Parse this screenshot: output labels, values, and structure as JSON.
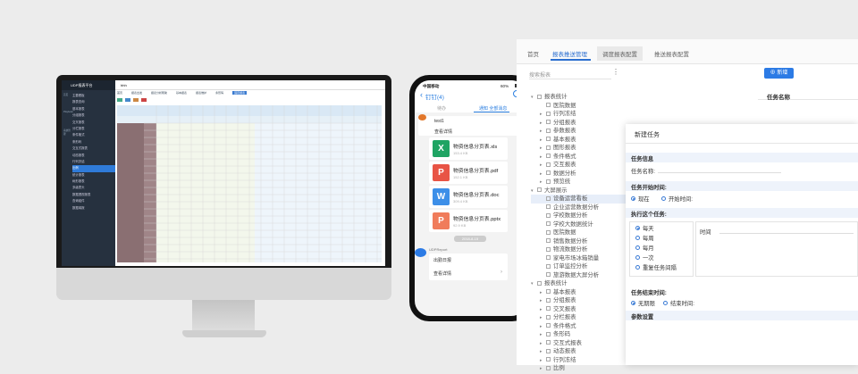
{
  "desktop": {
    "app_title": "UDP报表平台",
    "top_label": "hhh",
    "tabs": [
      "首页",
      "报表出发",
      "报表分析帮助",
      "基本报表",
      "报表维护",
      "条形码",
      "固定报表"
    ],
    "menu": [
      "主要看板",
      "报表查询",
      "基本报表",
      "分组报表",
      "交叉报表",
      "分栏报表",
      "条件格式",
      "条形码",
      "交互式报表",
      "动态报表",
      "行列冻结",
      "比例",
      "统计报表",
      "树形报表",
      "多级表头",
      "数据透视报表",
      "查询组件",
      "数据填报"
    ],
    "left_icons": [
      "首页",
      "Playbook",
      "系统管理"
    ]
  },
  "phone": {
    "carrier": "中国移动",
    "battery": "60%",
    "back_label": "钉钉(4)",
    "tab_left": "待办",
    "tab_right": "通知 全部消息",
    "sender": "test1",
    "view_detail": "查看详情",
    "files": [
      {
        "name": "物资信息分页表.xls",
        "size": "153.4 KB",
        "color": "#1fa463",
        "letter": "X"
      },
      {
        "name": "物资信息分页表.pdf",
        "size": "152.1 KB",
        "color": "#e85445",
        "letter": "P"
      },
      {
        "name": "物资信息分页表.doc",
        "size": "309.4 KB",
        "color": "#3d8fe8",
        "letter": "W"
      },
      {
        "name": "物资信息分页表.pptx",
        "size": "92.9 KB",
        "color": "#f07c5b",
        "letter": "P"
      }
    ],
    "time_badge": "2018-8-15",
    "bot_name": "UDPReport",
    "notice": "出勤日报",
    "view_detail2": "查看详情"
  },
  "manager": {
    "tabs": [
      "首页",
      "报表推送管理",
      "调度报表配置",
      "推送报表配置"
    ],
    "search_placeholder": "搜索报表",
    "new_button": "新增",
    "report_name_header": "任务名称",
    "tree": [
      {
        "label": "报表统计",
        "level": 0,
        "arrow": "▾"
      },
      {
        "label": "医院数据",
        "level": 1,
        "arrow": ""
      },
      {
        "label": "行列冻结",
        "level": 1,
        "arrow": "▸"
      },
      {
        "label": "分组报表",
        "level": 1,
        "arrow": "▸"
      },
      {
        "label": "参数报表",
        "level": 1,
        "arrow": "▸"
      },
      {
        "label": "基本报表",
        "level": 1,
        "arrow": "▸"
      },
      {
        "label": "图形报表",
        "level": 1,
        "arrow": "▸"
      },
      {
        "label": "条件格式",
        "level": 1,
        "arrow": "▸"
      },
      {
        "label": "交互报表",
        "level": 1,
        "arrow": "▸"
      },
      {
        "label": "数据分析",
        "level": 1,
        "arrow": "▸"
      },
      {
        "label": "预览统",
        "level": 1,
        "arrow": "▸"
      },
      {
        "label": "大屏展示",
        "level": 0,
        "arrow": "▾"
      },
      {
        "label": "设备运营看板",
        "level": 1,
        "arrow": ""
      },
      {
        "label": "企业运营数据分析",
        "level": 1,
        "arrow": ""
      },
      {
        "label": "学校数据分析",
        "level": 1,
        "arrow": ""
      },
      {
        "label": "学校大数据统计",
        "level": 1,
        "arrow": ""
      },
      {
        "label": "医院数据",
        "level": 1,
        "arrow": ""
      },
      {
        "label": "销售数据分析",
        "level": 1,
        "arrow": ""
      },
      {
        "label": "物流数据分析",
        "level": 1,
        "arrow": ""
      },
      {
        "label": "家电市场冰箱销量",
        "level": 1,
        "arrow": ""
      },
      {
        "label": "订单监控分析",
        "level": 1,
        "arrow": ""
      },
      {
        "label": "旅游数据大屏分析",
        "level": 1,
        "arrow": ""
      },
      {
        "label": "报表统计",
        "level": 0,
        "arrow": "▾"
      },
      {
        "label": "基本报表",
        "level": 1,
        "arrow": "▸"
      },
      {
        "label": "分组报表",
        "level": 1,
        "arrow": "▸"
      },
      {
        "label": "交叉报表",
        "level": 1,
        "arrow": "▸"
      },
      {
        "label": "分栏报表",
        "level": 1,
        "arrow": "▸"
      },
      {
        "label": "条件格式",
        "level": 1,
        "arrow": "▸"
      },
      {
        "label": "条形码",
        "level": 1,
        "arrow": "▸"
      },
      {
        "label": "交互式报表",
        "level": 1,
        "arrow": "▸"
      },
      {
        "label": "动态报表",
        "level": 1,
        "arrow": "▸"
      },
      {
        "label": "行列冻结",
        "level": 1,
        "arrow": "▸"
      },
      {
        "label": "比例",
        "level": 1,
        "arrow": "▸"
      }
    ],
    "dialog": {
      "title": "新建任务",
      "task_info": "任务信息",
      "task_name_label": "任务名称:",
      "start_section": "任务开始时间:",
      "now": "现在",
      "start_time_label": "开始时间:",
      "exec_section": "执行这个任务:",
      "options": [
        "每天",
        "每周",
        "每月",
        "一次",
        "重复任务间隔"
      ],
      "time_label": "时间",
      "end_section": "任务结束时间:",
      "no_end": "无期限",
      "end_time_label": "结束时间:",
      "params": "参数设置"
    }
  }
}
